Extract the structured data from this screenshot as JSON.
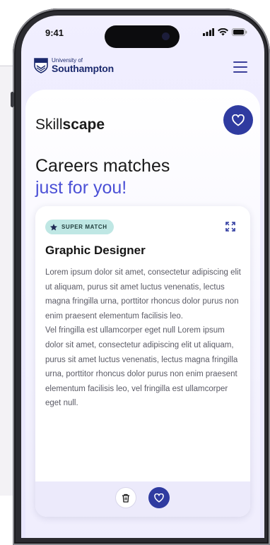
{
  "status_bar": {
    "time": "9:41"
  },
  "header": {
    "logo_line1": "University of",
    "logo_line2": "Southampton"
  },
  "app": {
    "brand_light": "Skill",
    "brand_bold": "scape"
  },
  "hero": {
    "line1": "Careers matches",
    "line2": "just for you!"
  },
  "card": {
    "badge": "SUPER MATCH",
    "title": "Graphic Designer",
    "description": "Lorem ipsum dolor sit amet, consectetur adipiscing elit ut aliquam, purus sit amet luctus venenatis, lectus magna fringilla urna, porttitor rhoncus dolor purus non enim praesent elementum facilisis leo.\nVel fringilla est ullamcorper eget null Lorem ipsum dolor sit amet, consectetur adipiscing elit ut aliquam, purus sit amet luctus venenatis, lectus magna fringilla urna, porttitor rhoncus dolor purus non enim praesent elementum facilisis leo, vel fringilla est ullamcorper eget null."
  },
  "colors": {
    "primary": "#2f3ba0",
    "accent_text": "#4b50d6",
    "badge_bg": "#bfe7e4"
  }
}
